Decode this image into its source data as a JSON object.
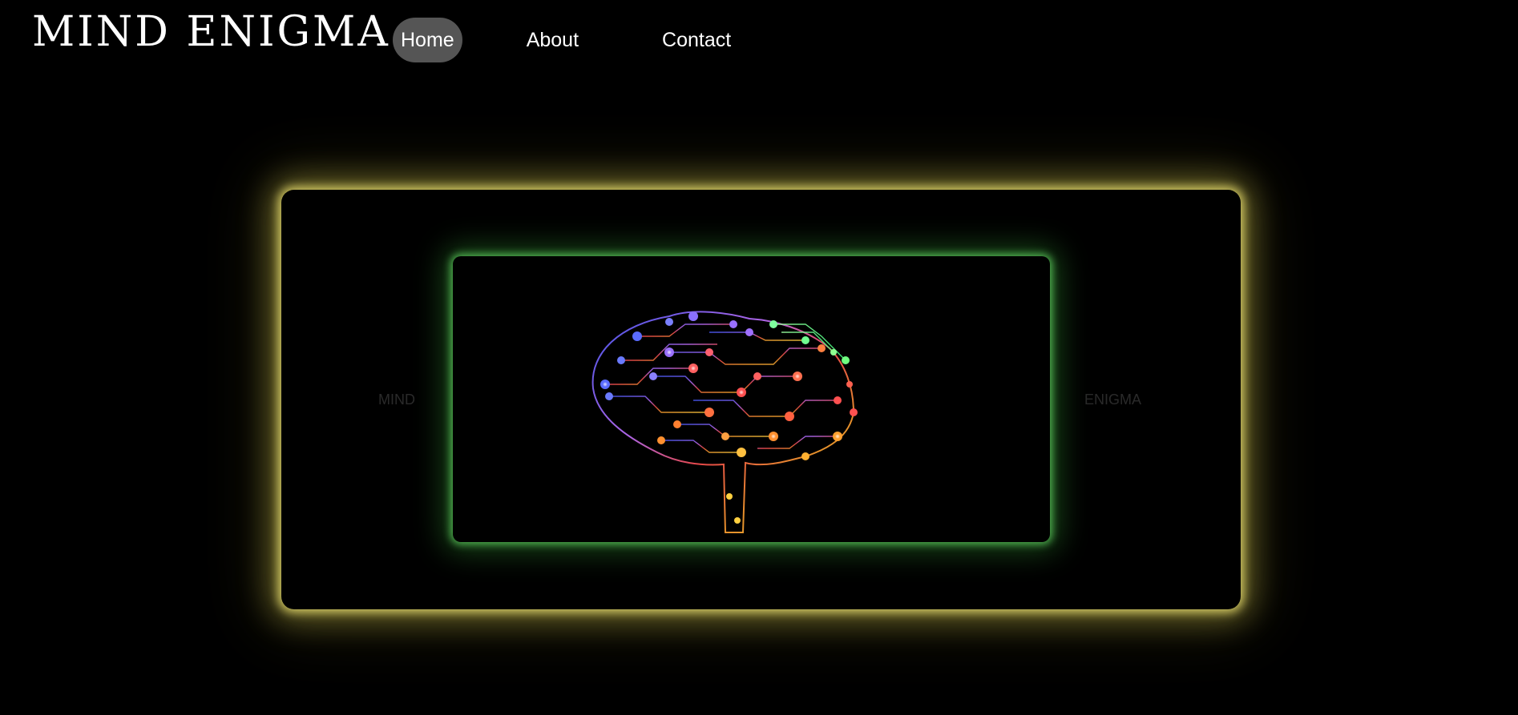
{
  "brand": {
    "title": "MIND ENIGMA"
  },
  "nav": {
    "items": [
      {
        "label": "Home",
        "active": true
      },
      {
        "label": "About",
        "active": false
      },
      {
        "label": "Contact",
        "active": false
      }
    ]
  },
  "hero": {
    "left_label": "MIND",
    "right_label": "ENIGMA",
    "image_icon": "circuit-brain-icon",
    "colors": {
      "outer_glow": "#e6dc6e",
      "inner_glow": "#5ac85a",
      "background": "#000000",
      "nav_active_bg": "#555555"
    }
  }
}
